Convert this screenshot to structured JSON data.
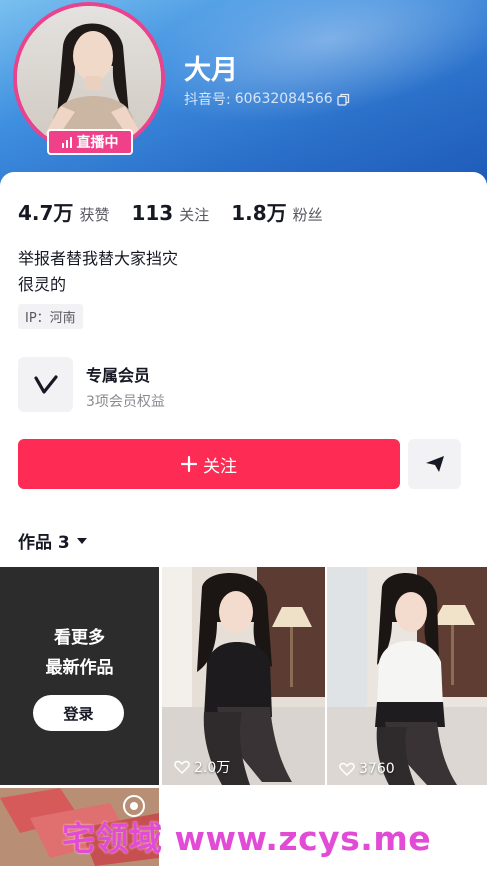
{
  "profile": {
    "name": "大月",
    "douyin_id_label": "抖音号: ",
    "douyin_id": "60632084566",
    "live_badge": "直播中"
  },
  "stats": [
    {
      "value": "4.7万",
      "label": "获赞"
    },
    {
      "value": "113",
      "label": "关注"
    },
    {
      "value": "1.8万",
      "label": "粉丝"
    }
  ],
  "bio": {
    "line1": "举报者替我替大家挡灾",
    "line2": "很灵的"
  },
  "ip_tag": "IP：河南",
  "membership": {
    "title": "专属会员",
    "subtitle": "3项会员权益"
  },
  "actions": {
    "follow_label": "关注",
    "follow_icon": "plus-icon",
    "share_icon": "send-icon"
  },
  "works": {
    "tab_label": "作品 3",
    "login_prompt_line1": "看更多",
    "login_prompt_line2": "最新作品",
    "login_button": "登录",
    "items": [
      {
        "likes": "2.0万"
      },
      {
        "likes": "3760"
      }
    ]
  },
  "watermark": "宅领域 www.zcys.me",
  "colors": {
    "accent": "#fe2c55",
    "live_badge": "#f0408a",
    "header_blue": "#2a6fc9",
    "watermark": "#e14bd6"
  }
}
